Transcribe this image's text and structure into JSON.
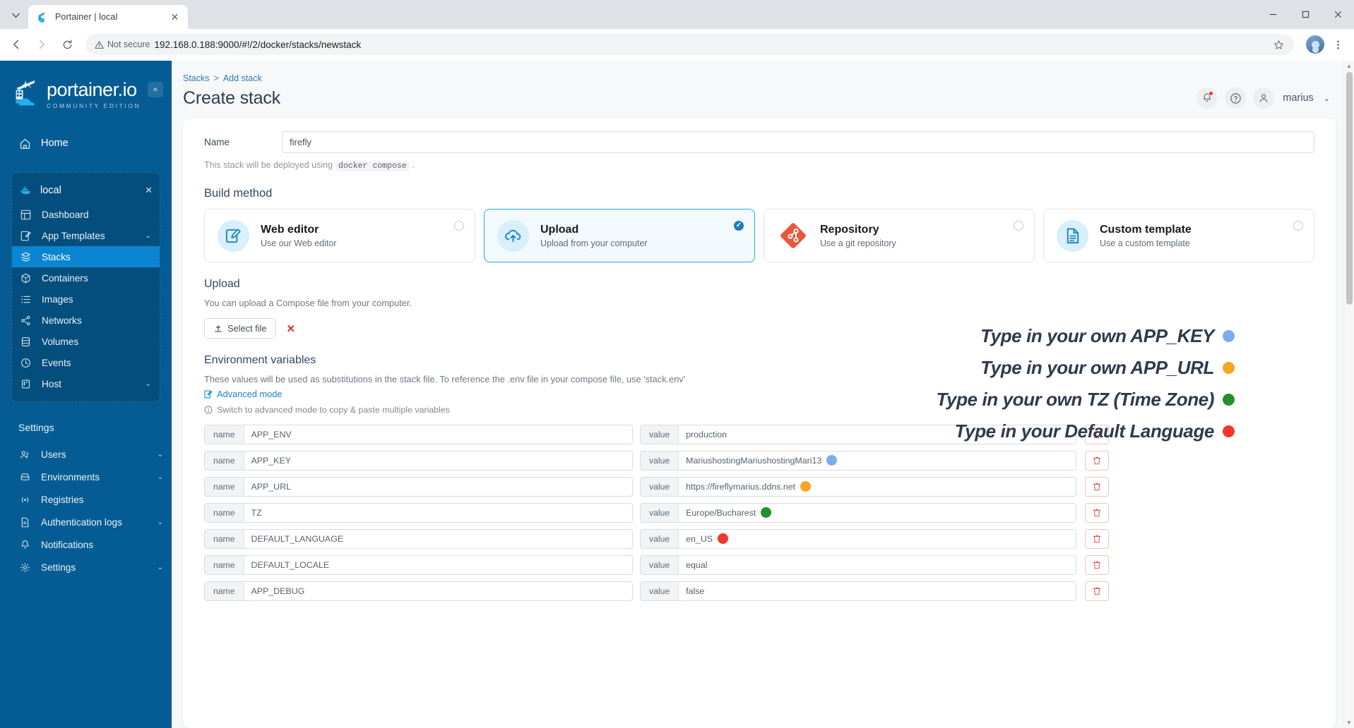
{
  "browser": {
    "tab": {
      "title": "Portainer | local",
      "favicon": "portainer-favicon",
      "close_label": "✕"
    },
    "tab_list_label": "⌄",
    "nav": {
      "back": "←",
      "forward": "→",
      "reload": "⟳"
    },
    "security_label": "Not secure",
    "url": "192.168.0.188:9000/#!/2/docker/stacks/newstack",
    "bookmark_label": "☆",
    "menu_label": "⋮",
    "window": {
      "minimize": "—",
      "maximize": "▢",
      "close": "✕"
    }
  },
  "sidebar": {
    "logo_title": "portainer.io",
    "logo_subtitle": "COMMUNITY EDITION",
    "collapse_label": "«",
    "home": {
      "label": "Home",
      "icon": "home-icon"
    },
    "environment": {
      "name": "local",
      "icon": "docker-icon",
      "close_label": "✕"
    },
    "env_items": [
      {
        "label": "Dashboard",
        "icon": "dashboard-icon",
        "chevron": "",
        "active": false
      },
      {
        "label": "App Templates",
        "icon": "template-icon",
        "chevron": "⌄",
        "active": false
      },
      {
        "label": "Stacks",
        "icon": "stacks-icon",
        "chevron": "",
        "active": true
      },
      {
        "label": "Containers",
        "icon": "container-icon",
        "chevron": "",
        "active": false
      },
      {
        "label": "Images",
        "icon": "images-icon",
        "chevron": "",
        "active": false
      },
      {
        "label": "Networks",
        "icon": "networks-icon",
        "chevron": "",
        "active": false
      },
      {
        "label": "Volumes",
        "icon": "volumes-icon",
        "chevron": "",
        "active": false
      },
      {
        "label": "Events",
        "icon": "events-icon",
        "chevron": "",
        "active": false
      },
      {
        "label": "Host",
        "icon": "host-icon",
        "chevron": "⌄",
        "active": false
      }
    ],
    "settings_label": "Settings",
    "settings_items": [
      {
        "label": "Users",
        "icon": "users-icon",
        "chevron": "⌄"
      },
      {
        "label": "Environments",
        "icon": "environments-icon",
        "chevron": "⌄"
      },
      {
        "label": "Registries",
        "icon": "registries-icon",
        "chevron": ""
      },
      {
        "label": "Authentication logs",
        "icon": "auth-logs-icon",
        "chevron": "⌄"
      },
      {
        "label": "Notifications",
        "icon": "notifications-icon",
        "chevron": ""
      },
      {
        "label": "Settings",
        "icon": "settings-icon",
        "chevron": "⌄"
      }
    ]
  },
  "header": {
    "breadcrumb_root": "Stacks",
    "breadcrumb_sep": ">",
    "breadcrumb_current": "Add stack",
    "title": "Create stack",
    "notifications_icon": "bell-icon",
    "help_icon": "question-circle-icon",
    "user_icon": "user-icon",
    "user_name": "marius",
    "user_chevron": "⌄"
  },
  "form": {
    "name_label": "Name",
    "name_value": "firefly",
    "deploy_note_prefix": "This stack will be deployed using",
    "deploy_note_code": "docker compose",
    "deploy_note_suffix": "."
  },
  "build_method": {
    "title": "Build method",
    "options": [
      {
        "title": "Web editor",
        "subtitle": "Use our Web editor",
        "icon": "web-editor-icon",
        "selected": false
      },
      {
        "title": "Upload",
        "subtitle": "Upload from your computer",
        "icon": "upload-cloud-icon",
        "selected": true
      },
      {
        "title": "Repository",
        "subtitle": "Use a git repository",
        "icon": "git-icon",
        "selected": false
      },
      {
        "title": "Custom template",
        "subtitle": "Use a custom template",
        "icon": "document-icon",
        "selected": false
      }
    ]
  },
  "upload": {
    "title": "Upload",
    "description": "You can upload a Compose file from your computer.",
    "select_file_label": "Select file",
    "select_file_icon": "upload-icon",
    "remove_label": "✕"
  },
  "env_section": {
    "title": "Environment variables",
    "description": "These values will be used as substitutions in the stack file. To reference the .env file in your compose file, use 'stack.env'",
    "advanced_mode_label": "Advanced mode",
    "advanced_mode_icon": "edit-icon",
    "switch_note": "Switch to advanced mode to copy & paste multiple variables",
    "switch_note_icon": "info-icon",
    "name_addon": "name",
    "value_addon": "value",
    "delete_icon": "trash-icon",
    "rows": [
      {
        "name": "APP_ENV",
        "value": "production",
        "dot": ""
      },
      {
        "name": "APP_KEY",
        "value": "MariushostingMariushostingMari13",
        "dot": "#78aef0"
      },
      {
        "name": "APP_URL",
        "value": "https://fireflymarius.ddns.net",
        "dot": "#f5a623"
      },
      {
        "name": "TZ",
        "value": "Europe/Bucharest",
        "dot": "#23912b"
      },
      {
        "name": "DEFAULT_LANGUAGE",
        "value": "en_US",
        "dot": "#f0372c"
      },
      {
        "name": "DEFAULT_LOCALE",
        "value": "equal",
        "dot": ""
      },
      {
        "name": "APP_DEBUG",
        "value": "false",
        "dot": ""
      }
    ]
  },
  "annotations": [
    {
      "text": "Type in your own  APP_KEY",
      "dot": "#78aef0"
    },
    {
      "text": "Type in your own APP_URL",
      "dot": "#f5a623"
    },
    {
      "text": "Type in your own TZ (Time Zone)",
      "dot": "#23912b"
    },
    {
      "text": "Type in your Default Language",
      "dot": "#f0372c"
    }
  ],
  "scrollbar": {
    "up": "▲",
    "down": "▼"
  }
}
